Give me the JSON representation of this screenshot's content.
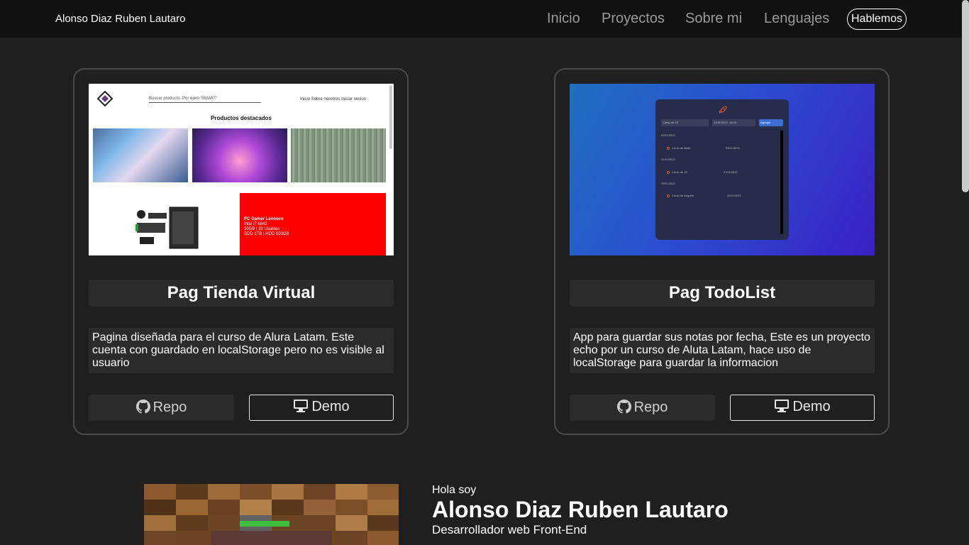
{
  "navbar": {
    "brand": "Alonso Diaz Ruben Lautaro",
    "links": [
      "Inicio",
      "Proyectos",
      "Sobre mi",
      "Lenguajes"
    ],
    "cta": "Hablemos"
  },
  "projects": [
    {
      "title": "Pag Tienda Virtual",
      "description": "Pagina diseñada para el curso de Alura Latam. Este cuenta con guardado en localStorage pero no es visible al usuario",
      "repo_label": "Repo",
      "demo_label": "Demo",
      "preview": {
        "search_placeholder": "Buscar producto. Por ejem 'SMART'",
        "nav": "Inicio   Sobre nosotros   Iniciar sesion",
        "heading": "Productos destacados",
        "promo_title": "PC Gamer Lennovo",
        "promo_line1": "Intel i7 6842",
        "promo_line2": "30GB | 30 Usables",
        "promo_line3": "SDD 1TB | HDD 500GB"
      }
    },
    {
      "title": "Pag TodoList",
      "description": "App para guardar sus notas por fecha, Este es un proyecto echo por un curso de Aluta Latam, hace uso de localStorage para guardar la informacion",
      "repo_label": "Repo",
      "demo_label": "Demo",
      "preview": {
        "task_input": "Curso de JS",
        "date_input": "21/11/2022, 14:04",
        "add_button": "Agregar",
        "groups": [
          {
            "date": "02/11/2022",
            "task": "Curso de Bash",
            "task_date": "03/11/2022"
          },
          {
            "date": "21/11/2022",
            "task": "Curso de JS",
            "task_date": "21/11/2022"
          },
          {
            "date": "30/11/2022",
            "task": "Curso de Angular",
            "task_date": "30/11/2022"
          }
        ]
      }
    }
  ],
  "hero": {
    "greeting": "Hola soy",
    "name": "Alonso Diaz Ruben Lautaro",
    "role": "Desarrollador web Front-End"
  },
  "colors": {
    "background": "#1f1f1f",
    "navbar": "#111111",
    "panel": "#2b2b2b",
    "card_border": "#4a4a4a"
  }
}
